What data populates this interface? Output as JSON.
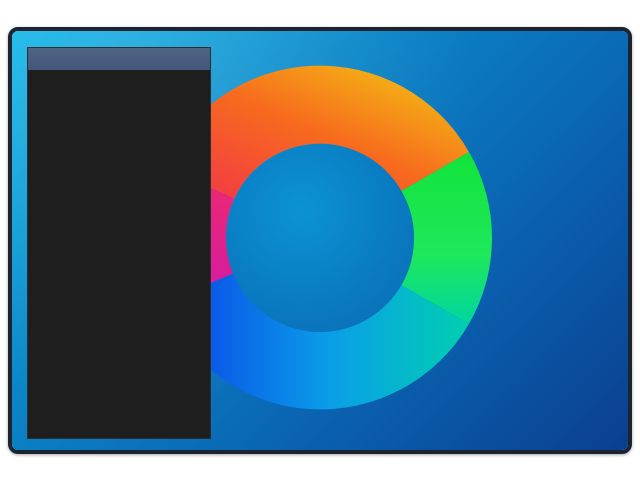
{
  "desktop": {
    "wallpaper": {
      "graphic": "color-wheel",
      "colors": {
        "background_light": "#11b6e8",
        "background_dark": "#0b3f8f",
        "ring_red": "#f2324a",
        "ring_orange": "#f76a1e",
        "ring_yellow": "#f3cf10",
        "ring_green": "#1ee83f",
        "ring_teal": "#00d5a0",
        "ring_blue": "#0a3fe8",
        "ring_magenta": "#e0169a"
      }
    }
  },
  "window": {
    "title": "",
    "title_bar_color": "#4a5e80",
    "body_color": "#1e1e1f"
  }
}
